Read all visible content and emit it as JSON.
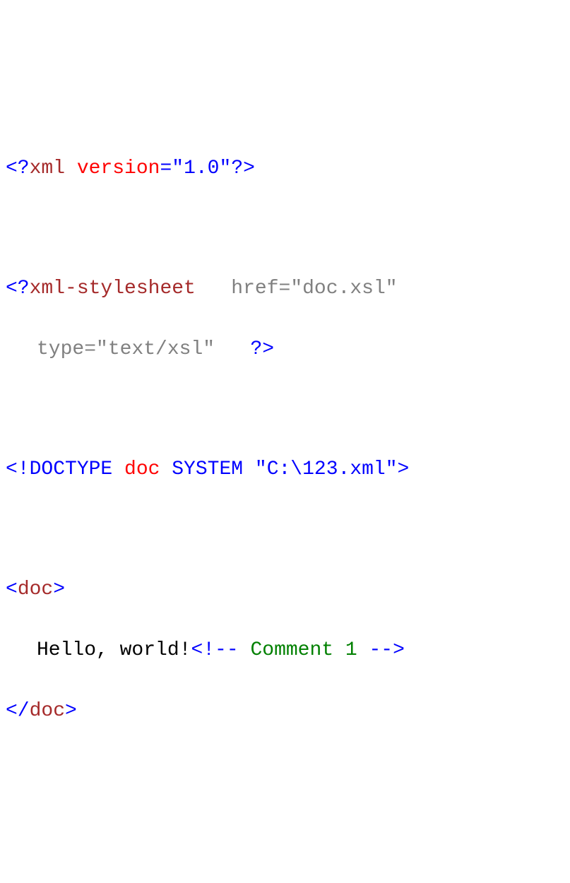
{
  "code": {
    "line1": {
      "open": "<?",
      "pi": "xml",
      "attr1": " version",
      "eq": "=",
      "q1": "\"",
      "val1": "1.0",
      "q2": "\"",
      "close": "?>"
    },
    "line2": {
      "open": "<?",
      "pi": "xml-stylesheet",
      "gap": "   ",
      "attr1": "href",
      "eq": "=",
      "q1": "\"",
      "val1": "doc.xsl",
      "q2": "\""
    },
    "line3": {
      "attr1": "type",
      "eq": "=",
      "q1": "\"",
      "val1": "text/xsl",
      "q2": "\"",
      "gap": "   ",
      "close": "?>"
    },
    "line4": {
      "open": "<!",
      "kw1": "DOCTYPE",
      "name": " doc ",
      "kw2": "SYSTEM",
      "sp": " ",
      "q1": "\"",
      "val": "C:\\123.xml",
      "q2": "\"",
      "close": ">"
    },
    "line5": {
      "open": "<",
      "tag": "doc",
      "close": ">"
    },
    "line6": {
      "text": "Hello, world!",
      "cmt_open": "<!--",
      "cmt": " Comment 1 ",
      "cmt_close": "-->"
    },
    "line7": {
      "open": "</",
      "tag": "doc",
      "close": ">"
    }
  }
}
